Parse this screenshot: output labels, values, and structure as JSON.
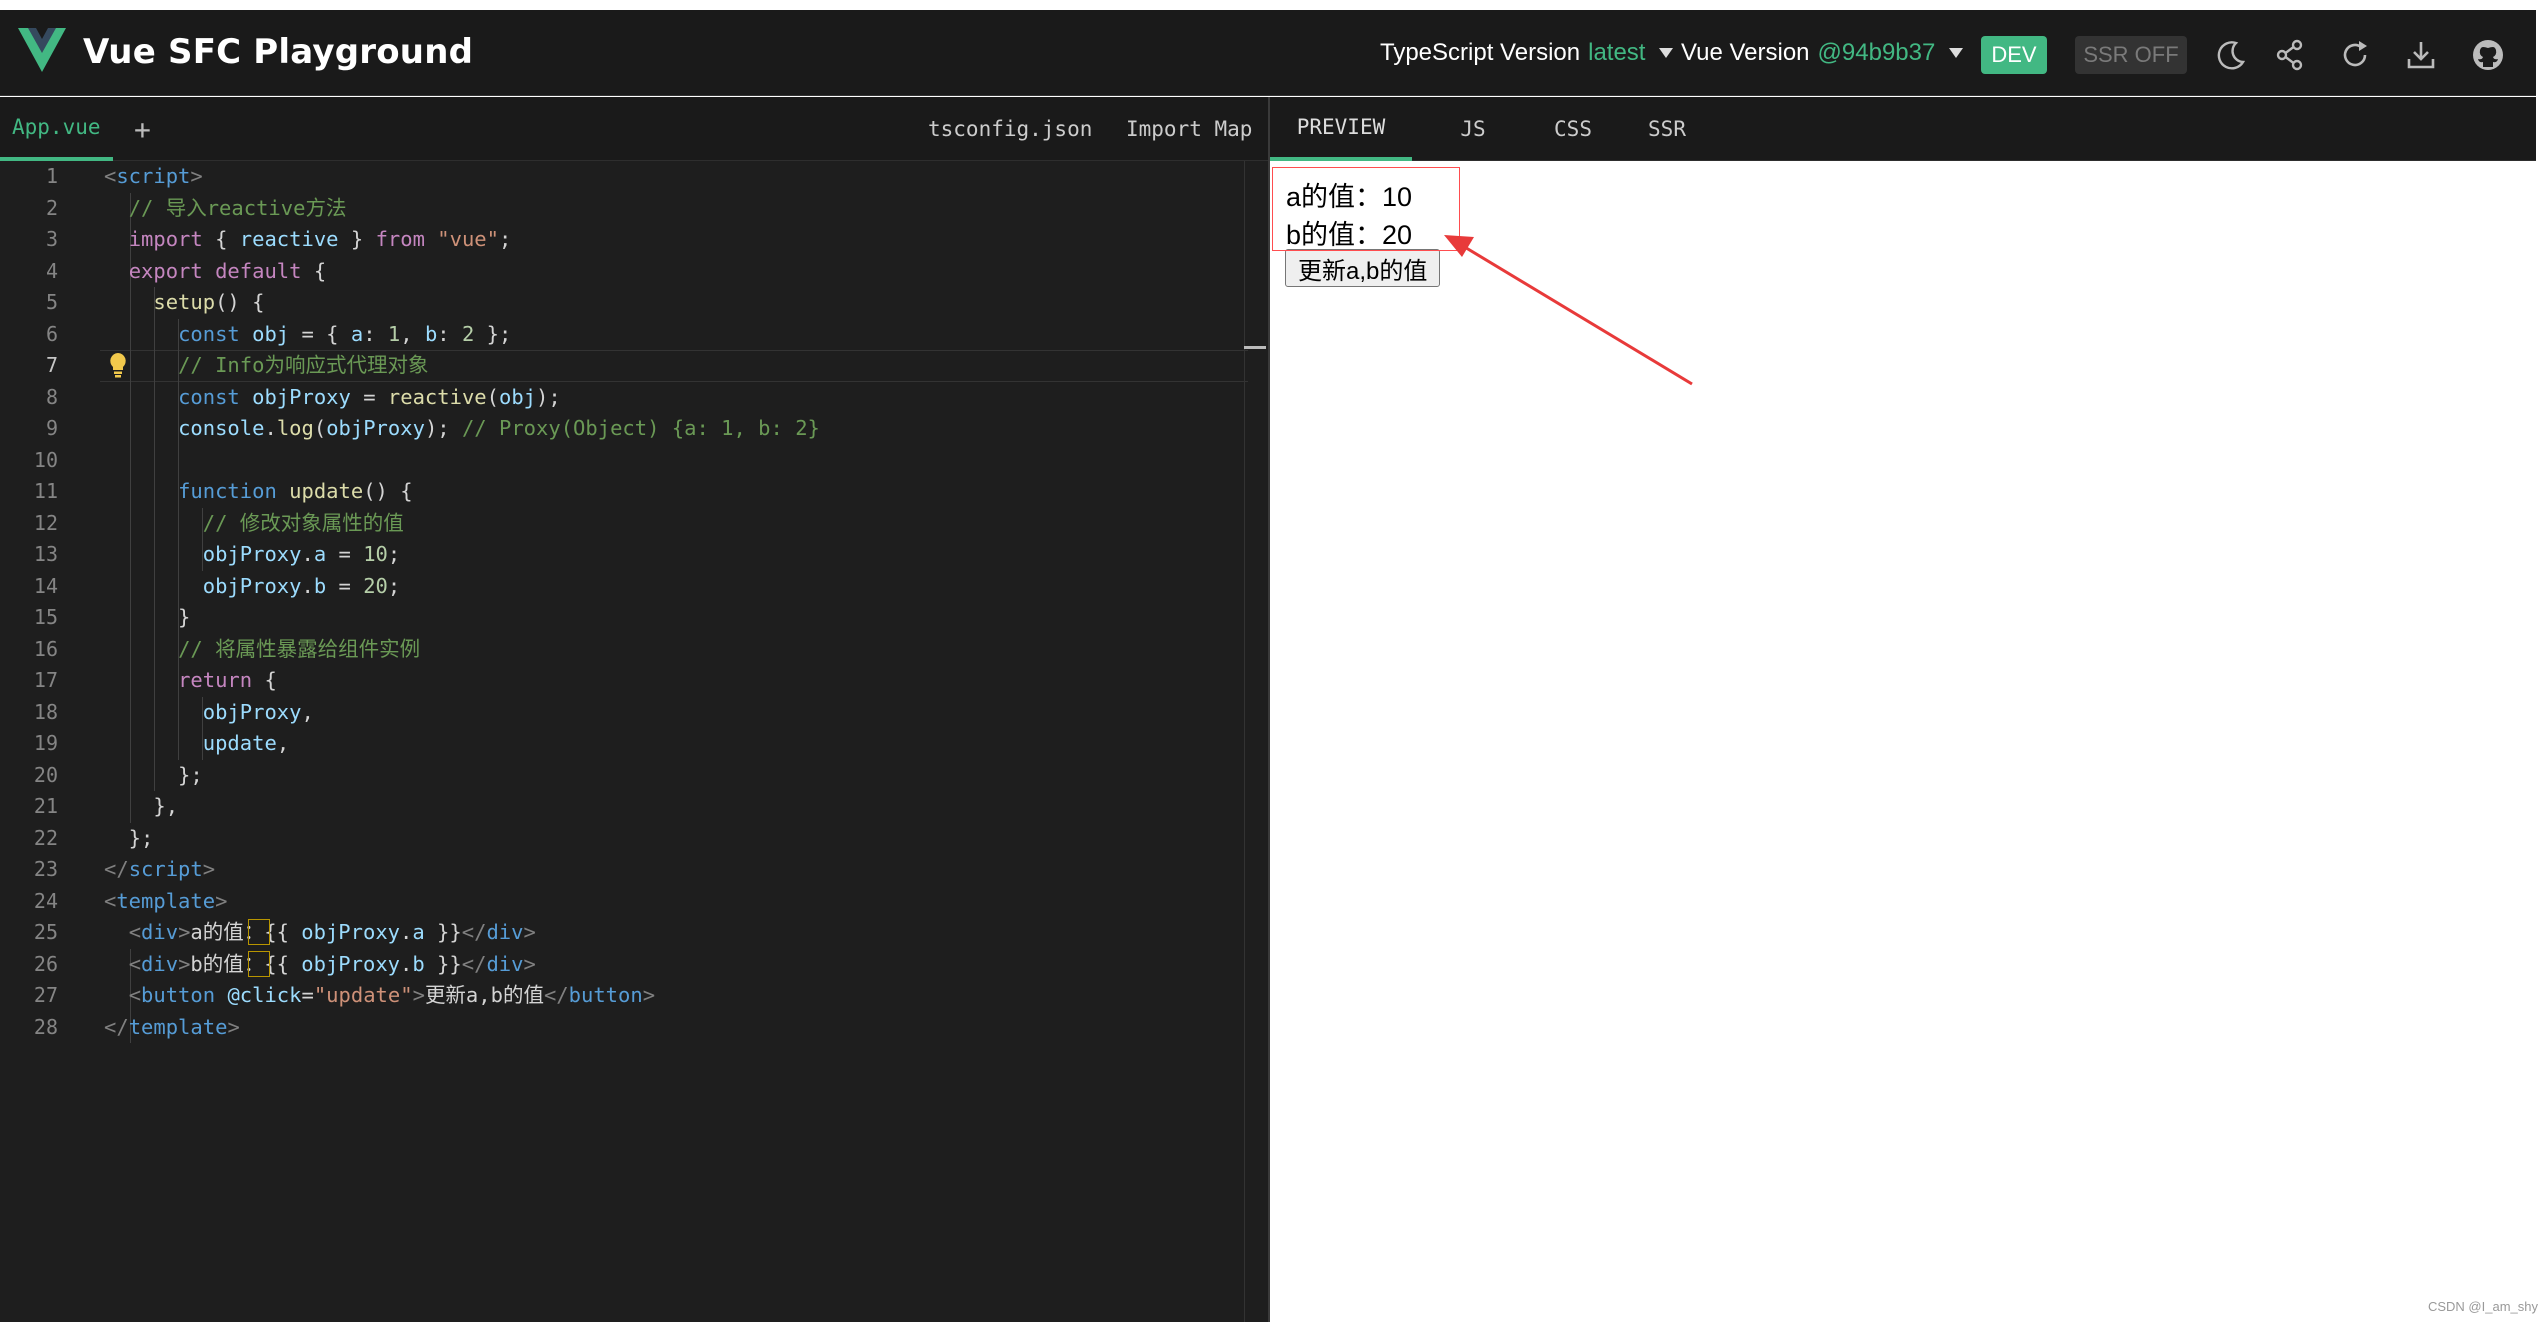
{
  "header": {
    "title": "Vue SFC Playground",
    "ts_label": "TypeScript Version",
    "ts_value": "latest",
    "vue_label": "Vue Version",
    "vue_value": "@94b9b37",
    "dev_badge": "DEV",
    "ssr_badge": "SSR OFF",
    "icons": [
      "moon-icon",
      "share-icon",
      "reload-icon",
      "download-icon",
      "github-icon"
    ],
    "accent": "#42b883"
  },
  "editor": {
    "active_file": "App.vue",
    "add_tab": "+",
    "right_tabs": [
      "tsconfig.json",
      "Import Map"
    ],
    "active_line": 7
  },
  "preview": {
    "tabs": [
      "PREVIEW",
      "JS",
      "CSS",
      "SSR"
    ],
    "active_tab": "PREVIEW",
    "output": {
      "line_a": "a的值：10",
      "line_b": "b的值：20",
      "button": "更新a,b的值"
    }
  },
  "watermark": "CSDN @I_am_shy"
}
